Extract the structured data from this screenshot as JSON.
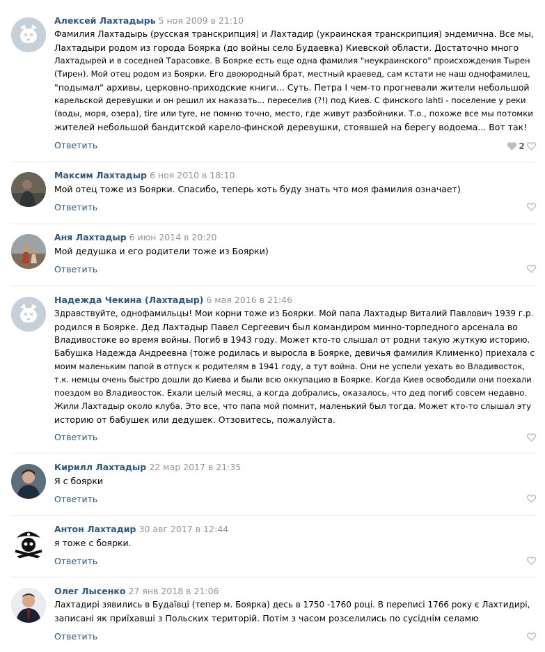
{
  "reply_label": "Ответить",
  "comments": [
    {
      "author": "Алексей Лахтадырь",
      "date": "5 ноя 2009 в 21:10",
      "avatar": "deactivated-dog-avatar",
      "lines": [
        "Фамилия Лахтадырь (русская транскрипция) и Лахтадир (украинская транскрипция) эндемична. Все мы,",
        "Лахтадыри родом из города Боярка (до войны село Будаевка) Киевской области. Достаточно много",
        "Лахтадырей и в соседней Тарасовке. В Боярке есть еще одна фамилия \"неукраинского\" происхождения Тырен",
        "(Тирен). Мой отец родом из Боярки. Его двоюродный брат, местный краевед, сам кстати не наш однофамилец,",
        "\"подымал\" архивы, церковно-приходские книги... Суть. Петра I чем-то прогневали жители небольшой",
        "карельской деревушки и он решил их наказать... переселив (?!) под Киев. С финского lahti - поселение у реки",
        "(воды, моря, озера), tire или tyre, не помню точно, место, где живут разбойники. Т.о., похоже все мы потомки",
        "жителей небольшой бандитской карело-финской деревушки, стоявшей на берегу водоема... Вот так!"
      ],
      "likes": "2"
    },
    {
      "author": "Максим Лахтадыр",
      "date": "6 ноя 2010 в 18:10",
      "avatar": "user-photo-avatar",
      "lines": [
        "Мой отец тоже из Боярки. Спасибо, теперь хоть буду знать что моя фамилия означает)"
      ],
      "likes": ""
    },
    {
      "author": "Аня Лахтадыр",
      "date": "6 июн 2014 в 20:20",
      "avatar": "user-photo-avatar",
      "lines": [
        "Мой дедушка и его родители тоже из Боярки)"
      ],
      "likes": ""
    },
    {
      "author": "Надежда Чекина (Лахтадыр)",
      "date": "6 мая 2016 в 21:46",
      "avatar": "deactivated-dog-avatar",
      "lines": [
        "Здравствуйте, однофамильцы! Мои корни тоже из Боярки. Мой папа Лахтадыр Виталий Павлович 1939 г.р.",
        "родился в Боярке. Дед Лахтадыр Павел Сергеевич был командиром минно-торпедного арсенала во",
        "Владивостоке во время войны. Погиб в 1943 году. Может кто-то слышал от родни такую жуткую историю.",
        "Бабушка Надежда Андреевна (тоже родилась и выросла в Боярке, девичья фамилия Клименко) приехала с",
        "моим маленьким папой в отпуск к родителям в 1941 году, а тут война. Они не успели уехать во Владивосток,",
        "т.к. немцы очень быстро дошли до Киева и были всю оккупацию в Боярке. Когда Киев освободили они поехали",
        "поездом во Владивосток. Ехали целый месяц, а когда добрались, оказалось, что дед погиб совсем недавно.",
        "Жили Лахтадыр около клуба. Это все, что папа мой помнит, маленький был тогда. Может кто-то слышал эту",
        "историю от бабушек или дедушек. Отзовитесь, пожалуйста."
      ],
      "likes": ""
    },
    {
      "author": "Кирилл Лахтадыр",
      "date": "22 мар 2017 в 21:35",
      "avatar": "user-photo-avatar",
      "lines": [
        "Я с боярки"
      ],
      "likes": ""
    },
    {
      "author": "Антон Лахтадир",
      "date": "30 авг 2017 в 12:44",
      "avatar": "pirate-skull-avatar",
      "lines": [
        "я тоже с боярки."
      ],
      "likes": ""
    },
    {
      "author": "Олег Лысенко",
      "date": "27 янв 2018 в 21:06",
      "avatar": "user-photo-avatar",
      "lines": [
        "Лахтадирі зявились в Будаївці (тепер м. Боярка) десь в 1750 -1760 році. В переписі 1766 року є Лахтидирі,",
        "записані як приїхавші з Польских територій. Потім з часом розселились по сусіднім селамю"
      ],
      "likes": ""
    }
  ]
}
